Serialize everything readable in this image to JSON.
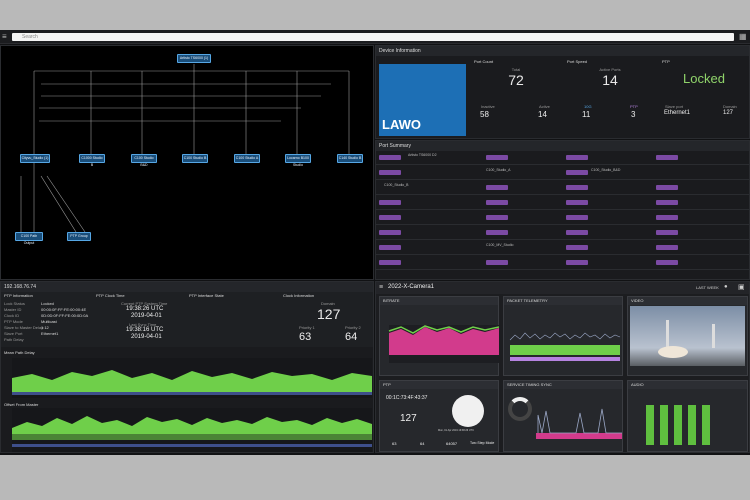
{
  "search": {
    "placeholder": "Search"
  },
  "topology": {
    "root": "Artisto TS6000 (1)",
    "children": [
      "Cityvu_Studio (1)",
      "C1000 Studio B",
      "C100 Studio B&D",
      "C100 Studio B",
      "C100 Studio A",
      "Locarno B100 Studio",
      "C140 Studio B"
    ],
    "leaves": [
      "C100 Path Output",
      "PTP Group"
    ]
  },
  "device": {
    "title": "Device Information",
    "logo": "LAWO",
    "port_count": {
      "label": "Port Count",
      "total_label": "Total",
      "total": "72",
      "inactive_label": "Inactive",
      "inactive": "58",
      "active_label": "Active",
      "active": "14"
    },
    "port_speed": {
      "label": "Port Speed",
      "active_label": "Active Ports",
      "active": "14",
      "a_label": "10G",
      "a": "11",
      "b_label": "PTP",
      "b": "3"
    },
    "ptp": {
      "label": "PTP",
      "status": "Locked",
      "slave_label": "Slave port",
      "slave": "Ethernet1",
      "domain_label": "Domain",
      "domain": "127"
    }
  },
  "summary": {
    "title": "Port Summary",
    "rows": [
      {
        "name": "Artisto TS6000 D2",
        "port": "0 Ethernet1"
      },
      {
        "name": "C100_Studio_A",
        "port": "0 Ethernet1"
      },
      {
        "name": "C100_Studio_B&D",
        "port": "0 Ethernet1"
      },
      {
        "name": "C100_Studio_B",
        "port": "0 Ethernet1"
      },
      {
        "name": "",
        "port": ""
      },
      {
        "name": "",
        "port": ""
      },
      {
        "name": "C100_MV_Studio",
        "port": "0 Ethernet1"
      }
    ]
  },
  "ptp_info": {
    "host": "192.168.76.74",
    "title": "PTP Information",
    "clock_title": "PTP Clock Time",
    "iface_title": "PTP Interface State",
    "clock_info_title": "Clock Information",
    "fields": [
      "Lock Status",
      "Master ID",
      "Clock ID",
      "PTP Mode",
      "Slave to Master Delay",
      "Slave Port",
      "Path Delay"
    ],
    "values": [
      "Locked",
      "00:00:0F:FF:FE:00:00:4E",
      "0D:0D:0F:FF:FE:00:0D:0A",
      "Multicast",
      "1:12",
      "Ethernet1",
      ""
    ],
    "current_label": "Current PTP System Time",
    "current_time": "19:38:26 UTC",
    "current_date": "2019-04-01",
    "last_label": "Last Sync Time",
    "last_time": "19:38:16 UTC",
    "last_date": "2019-04-01",
    "domain_label": "Domain",
    "domain": "127",
    "priority1_label": "Priority 1",
    "priority1": "63",
    "priority2_label": "Priority 2",
    "priority2": "64"
  },
  "charts": {
    "mean_path": "Mean Path Delay",
    "offset": "Offset From Master"
  },
  "camera": {
    "title": "2022-X-Camera1",
    "range": "LAST WEEK",
    "tiles": [
      "BITRATE",
      "PACKET TELEMETRY",
      "VIDEO",
      "PTP",
      "SERVICE TIMING SYNC",
      "AUDIO"
    ],
    "ptp_time": "00:1C:73:4F:43:37",
    "ptp_domain": "127",
    "ptp_date": "Mon, 01 Apr 2019 19:38:26 UTC",
    "ptp_vals": [
      "63",
      "64",
      "64057",
      "Two Step Mode"
    ]
  },
  "colors": {
    "accent": "#56a7e5",
    "locked": "#8fd36a",
    "chart": "#6fcf4a",
    "purple": "#7b4aa4"
  }
}
